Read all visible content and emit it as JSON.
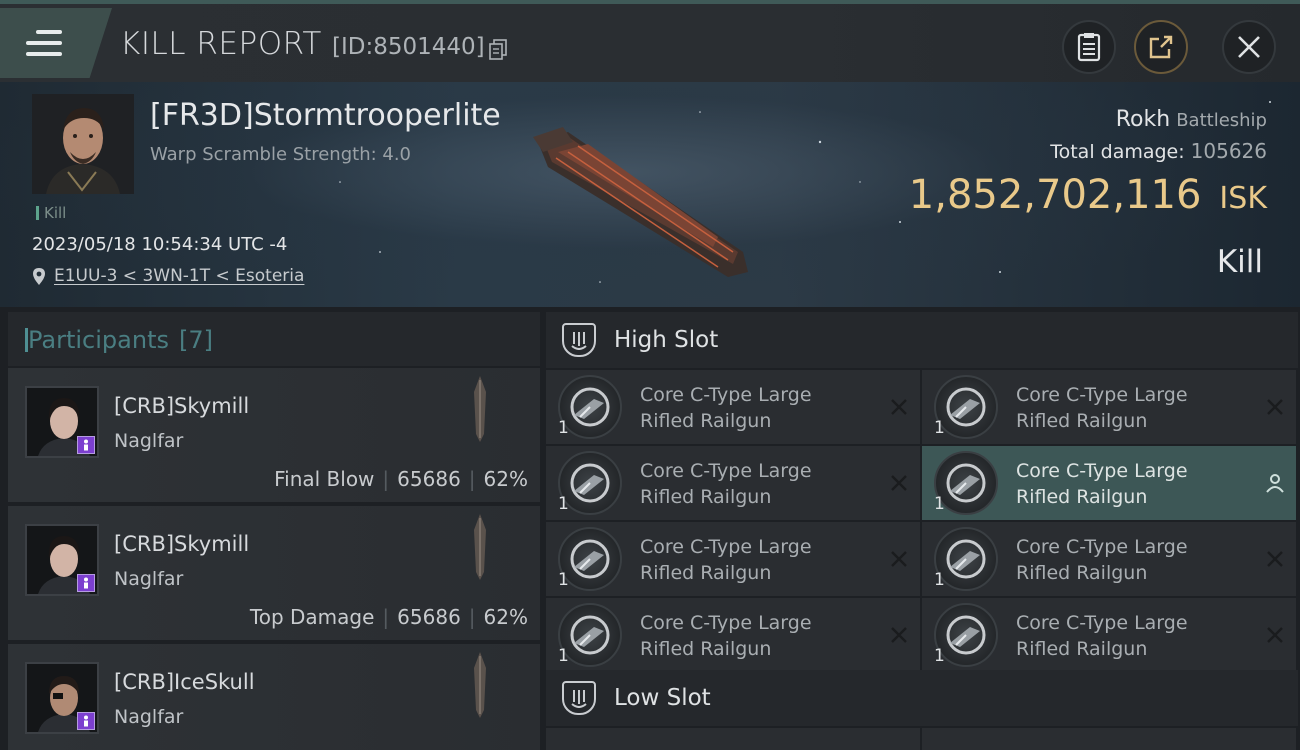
{
  "header": {
    "title": "KILL REPORT",
    "id_label": "[ID:8501440]"
  },
  "victim": {
    "name": "[FR3D]Stormtrooperlite",
    "warp_scramble": "Warp Scramble Strength: 4.0",
    "kill_tag": "Kill",
    "datetime": "2023/05/18 10:54:34 UTC -4",
    "location": "E1UU-3 < 3WN-1T < Esoteria",
    "ship_name": "Rokh",
    "ship_class": "Battleship",
    "total_damage_label": "Total damage:",
    "total_damage": "105626",
    "isk_value": "1,852,702,116",
    "isk_unit": "ISK",
    "result": "Kill"
  },
  "participants": {
    "title": "Participants",
    "count": "[7]",
    "list": [
      {
        "name": "[CRB]Skymill",
        "ship": "Naglfar",
        "role": "Final Blow",
        "damage": "65686",
        "percent": "62%"
      },
      {
        "name": "[CRB]Skymill",
        "ship": "Naglfar",
        "role": "Top Damage",
        "damage": "65686",
        "percent": "62%"
      },
      {
        "name": "[CRB]IceSkull",
        "ship": "Naglfar",
        "role": "",
        "damage": "",
        "percent": ""
      }
    ]
  },
  "slots": {
    "high_title": "High Slot",
    "low_title": "Low Slot",
    "high_items": [
      {
        "name": "Core C-Type Large Rifled Railgun",
        "qty": "1",
        "highlighted": false
      },
      {
        "name": "Core C-Type Large Rifled Railgun",
        "qty": "1",
        "highlighted": false
      },
      {
        "name": "Core C-Type Large Rifled Railgun",
        "qty": "1",
        "highlighted": false
      },
      {
        "name": "Core C-Type Large Rifled Railgun",
        "qty": "1",
        "highlighted": true
      },
      {
        "name": "Core C-Type Large Rifled Railgun",
        "qty": "1",
        "highlighted": false
      },
      {
        "name": "Core C-Type Large Rifled Railgun",
        "qty": "1",
        "highlighted": false
      },
      {
        "name": "Core C-Type Large Rifled Railgun",
        "qty": "1",
        "highlighted": false
      },
      {
        "name": "Core C-Type Large Rifled Railgun",
        "qty": "1",
        "highlighted": false
      }
    ]
  },
  "colors": {
    "accent_teal": "#4a7e82",
    "isk_gold": "#e9c98a",
    "highlight_row": "#3d5756",
    "badge_purple": "#7c3fcf"
  },
  "icons": {
    "menu": "hamburger-icon",
    "copy": "copy-icon",
    "clipboard": "clipboard-icon",
    "share": "share-icon",
    "close": "close-icon",
    "location": "location-pin-icon",
    "slot": "slot-shield-icon",
    "remove": "x-icon",
    "person": "person-icon"
  }
}
